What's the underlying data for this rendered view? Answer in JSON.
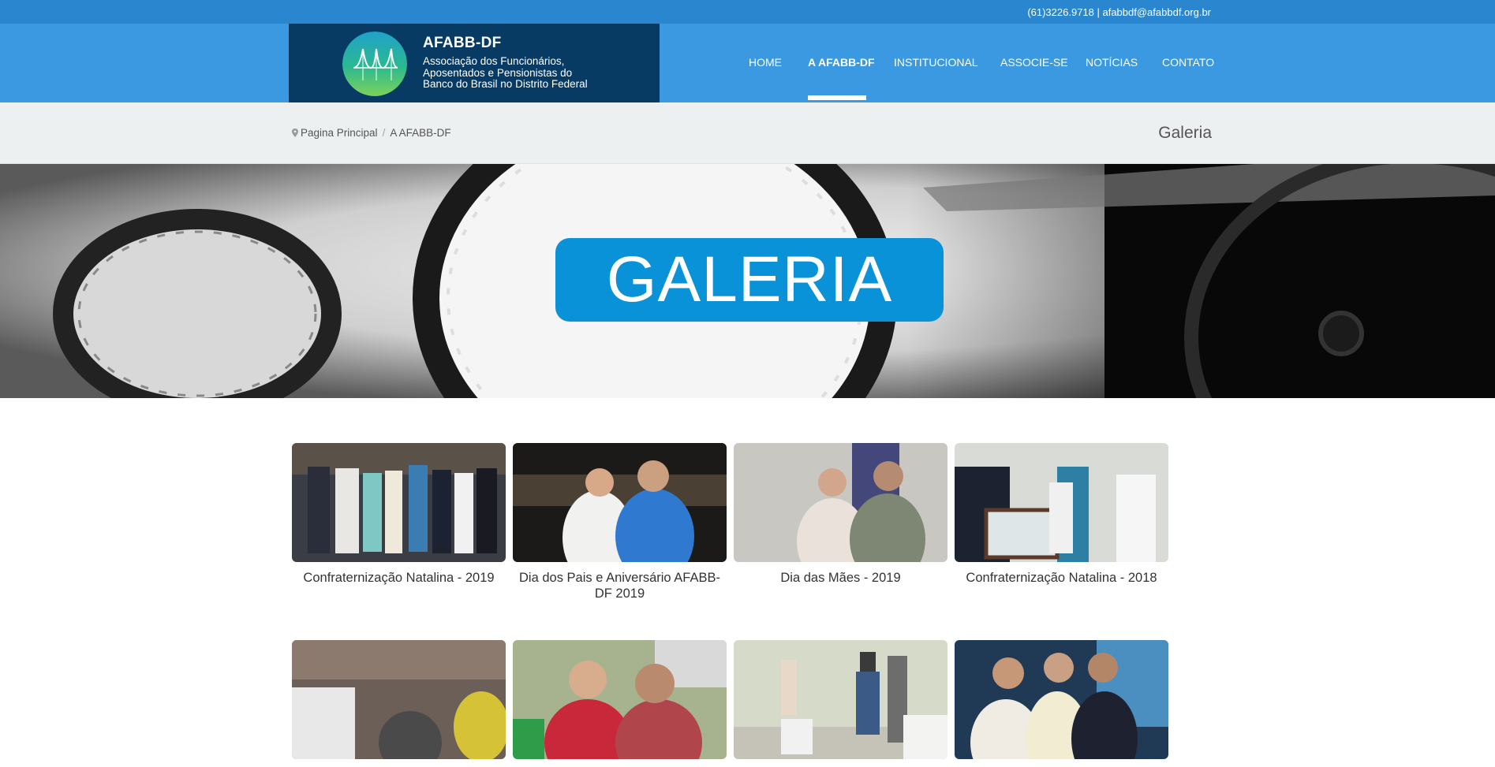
{
  "topbar": {
    "contact": "(61)3226.9718 | afabbdf@afabbdf.org.br"
  },
  "logo": {
    "name": "AFABB-DF",
    "desc_lines": [
      "Associação dos Funcionários,",
      "Aposentados e Pensionistas do",
      "Banco do Brasil no Distrito Federal"
    ]
  },
  "nav": {
    "items": [
      "HOME",
      "A AFABB-DF",
      "INSTITUCIONAL",
      "ASSOCIE-SE",
      "NOTÍCIAS",
      "CONTATO"
    ],
    "active": "A AFABB-DF"
  },
  "breadcrumb": {
    "home": "Pagina Principal",
    "current": "A AFABB-DF"
  },
  "page_title": "Galeria",
  "banner": {
    "text": "GALERIA"
  },
  "gallery": {
    "items": [
      {
        "caption": "Confraternização Natalina - 2019"
      },
      {
        "caption": "Dia dos Pais e Aniversário AFABB-DF 2019"
      },
      {
        "caption": "Dia das Mães - 2019"
      },
      {
        "caption": "Confraternização Natalina - 2018"
      },
      {
        "caption": ""
      },
      {
        "caption": ""
      },
      {
        "caption": ""
      },
      {
        "caption": ""
      }
    ]
  },
  "colors": {
    "topbar": "#2986cf",
    "header": "#3a99e0",
    "logo_bg": "#073b63",
    "banner_box": "#0a92d8"
  }
}
